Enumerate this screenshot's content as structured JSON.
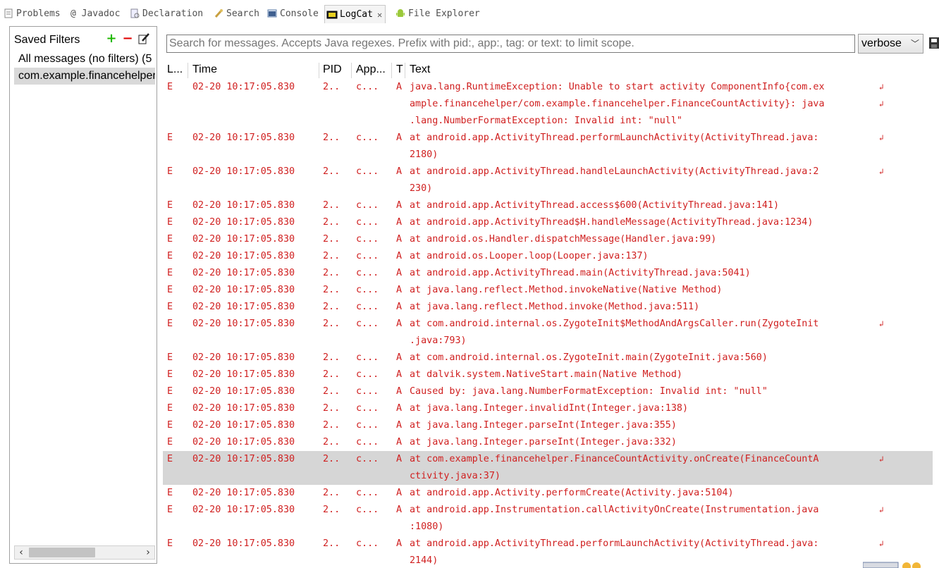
{
  "tabs": [
    {
      "label": "Problems",
      "icon": "problems-icon"
    },
    {
      "label": "@ Javadoc",
      "icon": ""
    },
    {
      "label": "Declaration",
      "icon": "declaration-icon"
    },
    {
      "label": "Search",
      "icon": "search-icon"
    },
    {
      "label": "Console",
      "icon": "console-icon"
    },
    {
      "label": "LogCat",
      "icon": "logcat-icon"
    },
    {
      "label": "File Explorer",
      "icon": "android-icon"
    }
  ],
  "filters": {
    "title": "Saved Filters",
    "items": [
      "All messages (no filters) (5",
      "com.example.financehelper"
    ]
  },
  "search": {
    "placeholder": "Search for messages. Accepts Java regexes. Prefix with pid:, app:, tag: or text: to limit scope.",
    "level": "verbose"
  },
  "columns": [
    "L...",
    "Time",
    "PID",
    "App...",
    "T",
    "Text"
  ],
  "rows": [
    {
      "level": "E",
      "time": "02-20 10:17:05.830",
      "pid": "2..",
      "app": "c...",
      "tag": "A",
      "text": [
        "java.lang.RuntimeException: Unable to start activity ComponentInfo{com.ex",
        "ample.financehelper/com.example.financehelper.FinanceCountActivity}: java",
        ".lang.NumberFormatException: Invalid int: \"null\""
      ]
    },
    {
      "level": "E",
      "time": "02-20 10:17:05.830",
      "pid": "2..",
      "app": "c...",
      "tag": "A",
      "text": [
        "at android.app.ActivityThread.performLaunchActivity(ActivityThread.java:",
        "2180)"
      ]
    },
    {
      "level": "E",
      "time": "02-20 10:17:05.830",
      "pid": "2..",
      "app": "c...",
      "tag": "A",
      "text": [
        "at android.app.ActivityThread.handleLaunchActivity(ActivityThread.java:2",
        "230)"
      ]
    },
    {
      "level": "E",
      "time": "02-20 10:17:05.830",
      "pid": "2..",
      "app": "c...",
      "tag": "A",
      "text": [
        "at android.app.ActivityThread.access$600(ActivityThread.java:141)"
      ]
    },
    {
      "level": "E",
      "time": "02-20 10:17:05.830",
      "pid": "2..",
      "app": "c...",
      "tag": "A",
      "text": [
        "at android.app.ActivityThread$H.handleMessage(ActivityThread.java:1234)"
      ]
    },
    {
      "level": "E",
      "time": "02-20 10:17:05.830",
      "pid": "2..",
      "app": "c...",
      "tag": "A",
      "text": [
        "at android.os.Handler.dispatchMessage(Handler.java:99)"
      ]
    },
    {
      "level": "E",
      "time": "02-20 10:17:05.830",
      "pid": "2..",
      "app": "c...",
      "tag": "A",
      "text": [
        "at android.os.Looper.loop(Looper.java:137)"
      ]
    },
    {
      "level": "E",
      "time": "02-20 10:17:05.830",
      "pid": "2..",
      "app": "c...",
      "tag": "A",
      "text": [
        "at android.app.ActivityThread.main(ActivityThread.java:5041)"
      ]
    },
    {
      "level": "E",
      "time": "02-20 10:17:05.830",
      "pid": "2..",
      "app": "c...",
      "tag": "A",
      "text": [
        "at java.lang.reflect.Method.invokeNative(Native Method)"
      ]
    },
    {
      "level": "E",
      "time": "02-20 10:17:05.830",
      "pid": "2..",
      "app": "c...",
      "tag": "A",
      "text": [
        "at java.lang.reflect.Method.invoke(Method.java:511)"
      ]
    },
    {
      "level": "E",
      "time": "02-20 10:17:05.830",
      "pid": "2..",
      "app": "c...",
      "tag": "A",
      "text": [
        "at com.android.internal.os.ZygoteInit$MethodAndArgsCaller.run(ZygoteInit",
        ".java:793)"
      ]
    },
    {
      "level": "E",
      "time": "02-20 10:17:05.830",
      "pid": "2..",
      "app": "c...",
      "tag": "A",
      "text": [
        "at com.android.internal.os.ZygoteInit.main(ZygoteInit.java:560)"
      ]
    },
    {
      "level": "E",
      "time": "02-20 10:17:05.830",
      "pid": "2..",
      "app": "c...",
      "tag": "A",
      "text": [
        "at dalvik.system.NativeStart.main(Native Method)"
      ]
    },
    {
      "level": "E",
      "time": "02-20 10:17:05.830",
      "pid": "2..",
      "app": "c...",
      "tag": "A",
      "text": [
        "Caused by: java.lang.NumberFormatException: Invalid int: \"null\""
      ]
    },
    {
      "level": "E",
      "time": "02-20 10:17:05.830",
      "pid": "2..",
      "app": "c...",
      "tag": "A",
      "text": [
        "at java.lang.Integer.invalidInt(Integer.java:138)"
      ]
    },
    {
      "level": "E",
      "time": "02-20 10:17:05.830",
      "pid": "2..",
      "app": "c...",
      "tag": "A",
      "text": [
        "at java.lang.Integer.parseInt(Integer.java:355)"
      ]
    },
    {
      "level": "E",
      "time": "02-20 10:17:05.830",
      "pid": "2..",
      "app": "c...",
      "tag": "A",
      "text": [
        "at java.lang.Integer.parseInt(Integer.java:332)"
      ]
    },
    {
      "level": "E",
      "time": "02-20 10:17:05.830",
      "pid": "2..",
      "app": "c...",
      "tag": "A",
      "selected": true,
      "text": [
        "at com.example.financehelper.FinanceCountActivity.onCreate(FinanceCountA",
        "ctivity.java:37)"
      ]
    },
    {
      "level": "E",
      "time": "02-20 10:17:05.830",
      "pid": "2..",
      "app": "c...",
      "tag": "A",
      "text": [
        "at android.app.Activity.performCreate(Activity.java:5104)"
      ]
    },
    {
      "level": "E",
      "time": "02-20 10:17:05.830",
      "pid": "2..",
      "app": "c...",
      "tag": "A",
      "text": [
        "at android.app.Instrumentation.callActivityOnCreate(Instrumentation.java",
        ":1080)"
      ]
    },
    {
      "level": "E",
      "time": "02-20 10:17:05.830",
      "pid": "2..",
      "app": "c...",
      "tag": "A",
      "text": [
        "at android.app.ActivityThread.performLaunchActivity(ActivityThread.java:",
        "2144)"
      ]
    }
  ],
  "colors": {
    "error": "#d02020",
    "selected_row": "#d6d6d6",
    "add": "#1fb800",
    "remove": "#e00000"
  }
}
